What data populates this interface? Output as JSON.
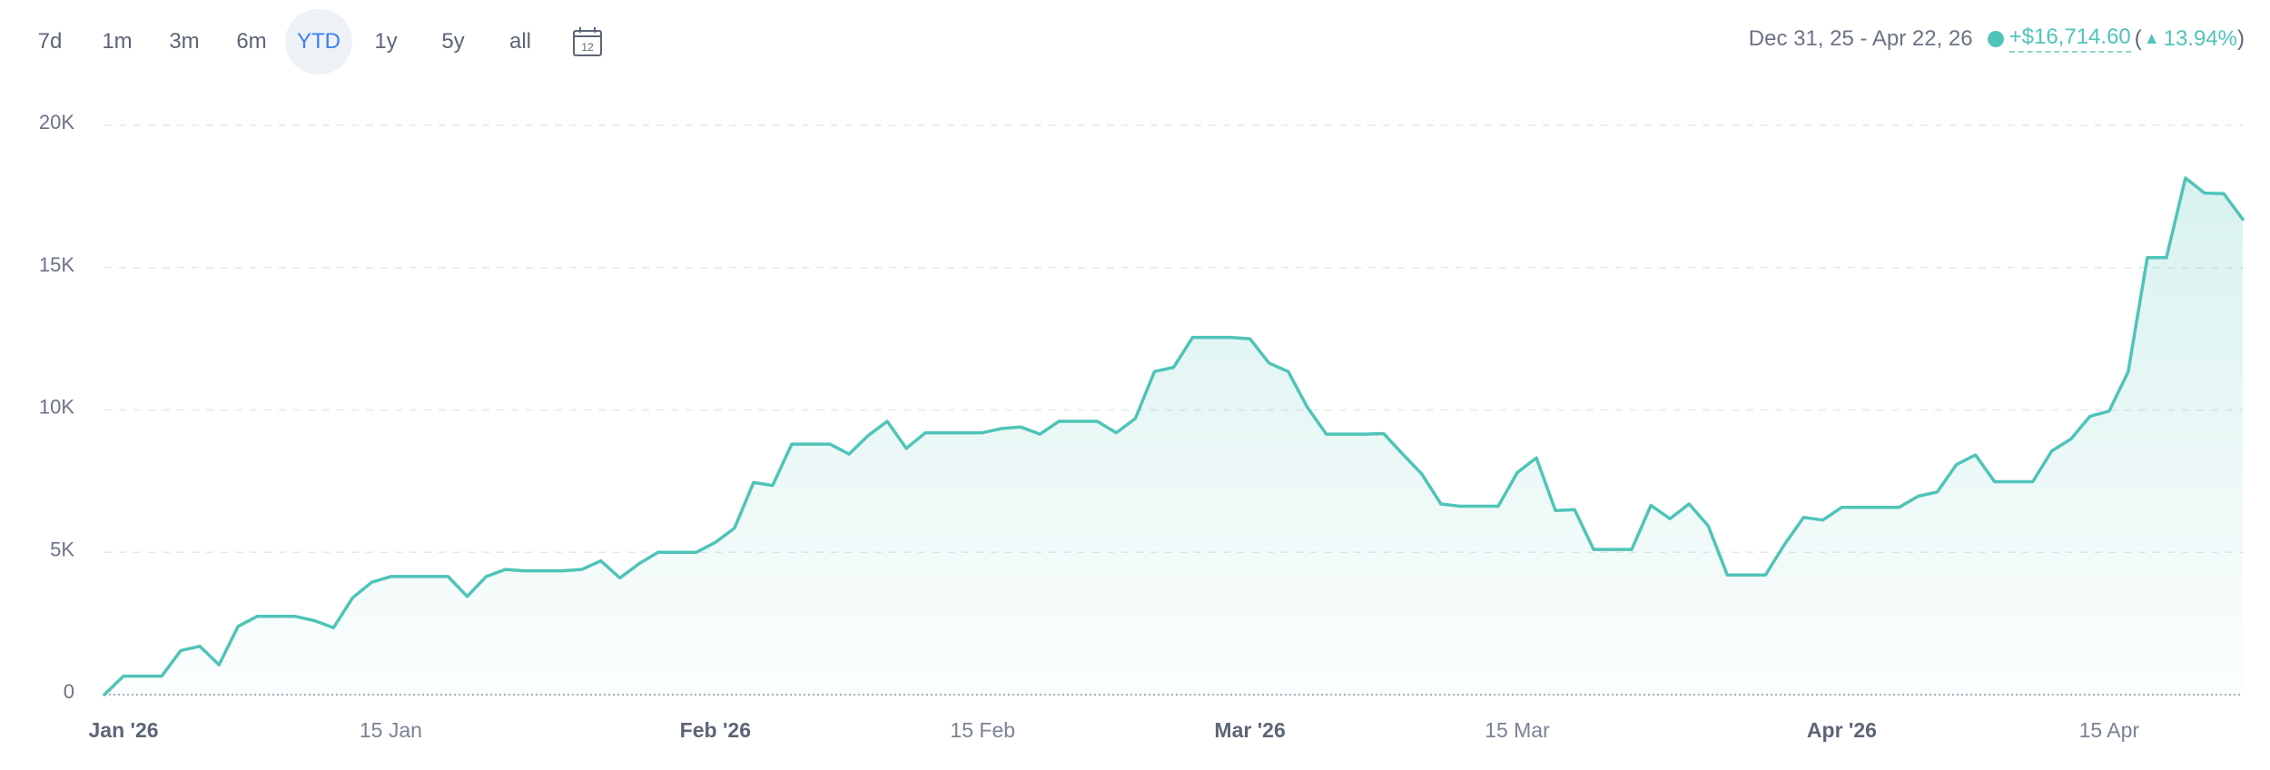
{
  "toolbar": {
    "ranges": [
      {
        "label": "7d",
        "active": false
      },
      {
        "label": "1m",
        "active": false
      },
      {
        "label": "3m",
        "active": false
      },
      {
        "label": "6m",
        "active": false
      },
      {
        "label": "YTD",
        "active": true
      },
      {
        "label": "1y",
        "active": false
      },
      {
        "label": "5y",
        "active": false
      },
      {
        "label": "all",
        "active": false
      }
    ],
    "calendar_icon": "calendar-icon",
    "calendar_day": "12"
  },
  "summary": {
    "date_range": "Dec 31, 25 - Apr 22, 26",
    "change": "+$16,714.60",
    "open_paren": "(",
    "percent": "13.94%",
    "close_paren": ")",
    "dot_icon": "series-dot-icon",
    "up_icon": "triangle-up-icon"
  },
  "colors": {
    "accent": "#4fc4b8",
    "active_range": "#3b82f6",
    "grid": "#e4e7ec",
    "text": "#6b7385"
  },
  "chart_data": {
    "type": "area",
    "title": "",
    "xlabel": "",
    "ylabel": "",
    "ylim": [
      0,
      20000
    ],
    "yticks": [
      "0",
      "5K",
      "10K",
      "15K",
      "20K"
    ],
    "ytick_values": [
      0,
      5000,
      10000,
      15000,
      20000
    ],
    "xticks": [
      {
        "label": "Jan '26",
        "date": "2026-01-01",
        "major": true
      },
      {
        "label": "15 Jan",
        "date": "2026-01-15",
        "major": false
      },
      {
        "label": "Feb '26",
        "date": "2026-02-01",
        "major": true
      },
      {
        "label": "15 Feb",
        "date": "2026-02-15",
        "major": false
      },
      {
        "label": "Mar '26",
        "date": "2026-03-01",
        "major": true
      },
      {
        "label": "15 Mar",
        "date": "2026-03-15",
        "major": false
      },
      {
        "label": "Apr '26",
        "date": "2026-04-01",
        "major": true
      },
      {
        "label": "15 Apr",
        "date": "2026-04-15",
        "major": false
      }
    ],
    "xlim": [
      "2025-12-31",
      "2026-04-22"
    ],
    "grid": true,
    "series": [
      {
        "x": [
          "2025-12-31",
          "2026-01-01",
          "2026-01-02",
          "2026-01-03",
          "2026-01-04",
          "2026-01-05",
          "2026-01-06",
          "2026-01-07",
          "2026-01-08",
          "2026-01-09",
          "2026-01-10",
          "2026-01-11",
          "2026-01-12",
          "2026-01-13",
          "2026-01-14",
          "2026-01-15",
          "2026-01-16",
          "2026-01-17",
          "2026-01-18",
          "2026-01-19",
          "2026-01-20",
          "2026-01-21",
          "2026-01-22",
          "2026-01-23",
          "2026-01-24",
          "2026-01-25",
          "2026-01-26",
          "2026-01-27",
          "2026-01-28",
          "2026-01-29",
          "2026-01-30",
          "2026-01-31",
          "2026-02-01",
          "2026-02-02",
          "2026-02-03",
          "2026-02-04",
          "2026-02-05",
          "2026-02-06",
          "2026-02-07",
          "2026-02-08",
          "2026-02-09",
          "2026-02-10",
          "2026-02-11",
          "2026-02-12",
          "2026-02-13",
          "2026-02-14",
          "2026-02-15",
          "2026-02-16",
          "2026-02-17",
          "2026-02-18",
          "2026-02-19",
          "2026-02-20",
          "2026-02-21",
          "2026-02-22",
          "2026-02-23",
          "2026-02-24",
          "2026-02-25",
          "2026-02-26",
          "2026-02-27",
          "2026-02-28",
          "2026-03-01",
          "2026-03-02",
          "2026-03-03",
          "2026-03-04",
          "2026-03-05",
          "2026-03-06",
          "2026-03-07",
          "2026-03-08",
          "2026-03-09",
          "2026-03-10",
          "2026-03-11",
          "2026-03-12",
          "2026-03-13",
          "2026-03-14",
          "2026-03-15",
          "2026-03-16",
          "2026-03-17",
          "2026-03-18",
          "2026-03-19",
          "2026-03-20",
          "2026-03-21",
          "2026-03-22",
          "2026-03-23",
          "2026-03-24",
          "2026-03-25",
          "2026-03-26",
          "2026-03-27",
          "2026-03-28",
          "2026-03-29",
          "2026-03-30",
          "2026-03-31",
          "2026-04-01",
          "2026-04-02",
          "2026-04-03",
          "2026-04-04",
          "2026-04-05",
          "2026-04-06",
          "2026-04-07",
          "2026-04-08",
          "2026-04-09",
          "2026-04-10",
          "2026-04-11",
          "2026-04-12",
          "2026-04-13",
          "2026-04-14",
          "2026-04-15",
          "2026-04-16",
          "2026-04-17",
          "2026-04-18",
          "2026-04-19",
          "2026-04-20",
          "2026-04-21",
          "2026-04-22"
        ],
        "values": [
          0,
          650,
          650,
          650,
          1550,
          1700,
          1050,
          2400,
          2750,
          2750,
          2750,
          2600,
          2350,
          3400,
          3950,
          4150,
          4150,
          4150,
          4150,
          3450,
          4150,
          4400,
          4350,
          4350,
          4350,
          4400,
          4700,
          4100,
          4600,
          5000,
          5000,
          5000,
          5350,
          5850,
          7450,
          7350,
          8800,
          8800,
          8800,
          8450,
          9100,
          9600,
          8650,
          9200,
          9200,
          9200,
          9200,
          9350,
          9400,
          9150,
          9600,
          9600,
          9600,
          9200,
          9700,
          11350,
          11500,
          12550,
          12550,
          12550,
          12500,
          11650,
          11350,
          10100,
          9150,
          9150,
          9150,
          9170,
          8450,
          7750,
          6700,
          6620,
          6620,
          6620,
          7800,
          8320,
          6470,
          6500,
          5100,
          5100,
          5100,
          6650,
          6180,
          6700,
          5930,
          4200,
          4200,
          4200,
          5280,
          6230,
          6130,
          6580,
          6580,
          6580,
          6580,
          6970,
          7120,
          8080,
          8420,
          7480,
          7480,
          7480,
          8560,
          8980,
          9780,
          9960,
          11340,
          15350,
          15350,
          18150,
          17620,
          17600,
          16700
        ]
      }
    ]
  }
}
